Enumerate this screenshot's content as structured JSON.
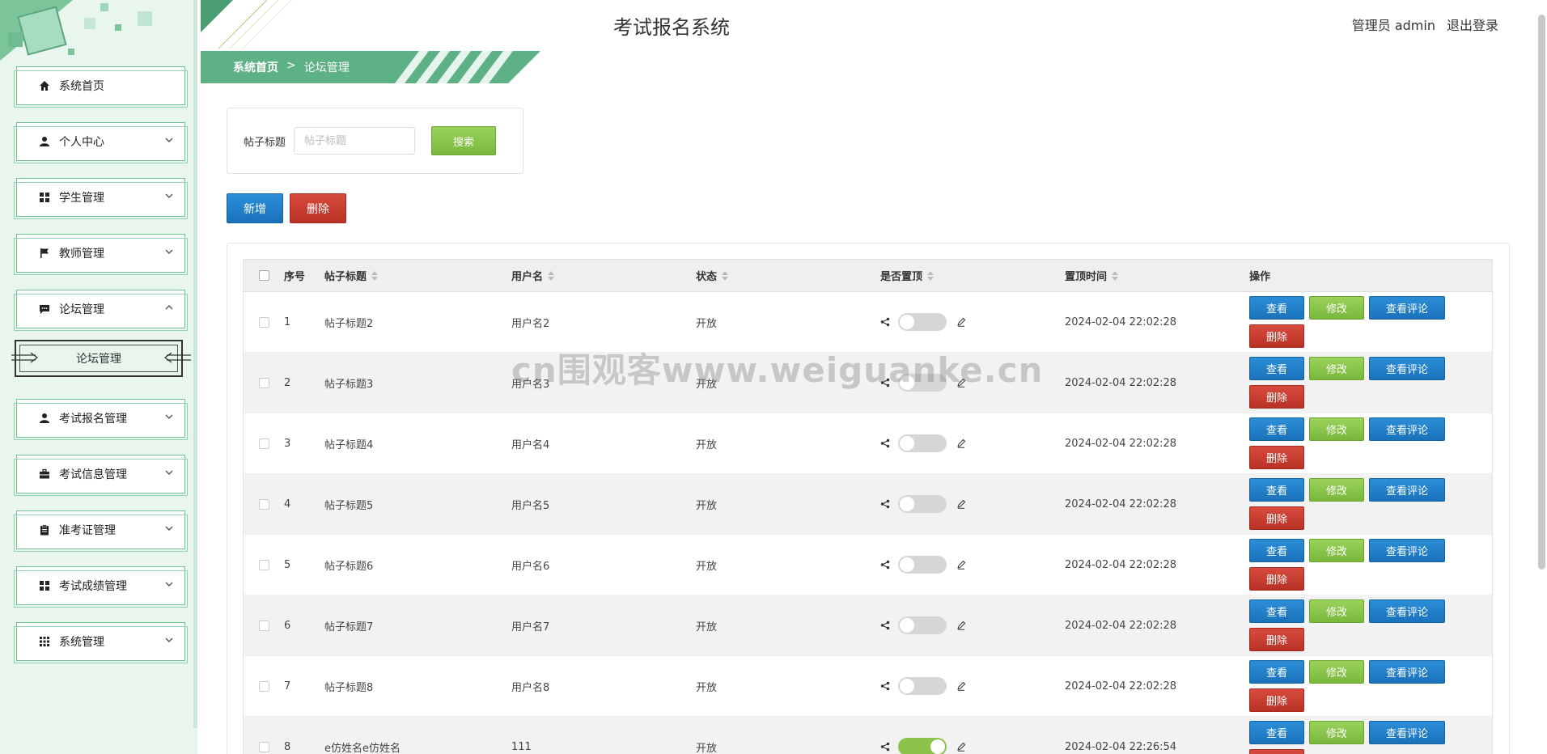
{
  "app": {
    "title": "考试报名系统"
  },
  "header": {
    "user": "管理员 admin",
    "logout": "退出登录"
  },
  "breadcrumb": {
    "home": "系统首页",
    "sep": ">",
    "current": "论坛管理"
  },
  "sidebar": {
    "items": [
      {
        "label": "系统首页",
        "icon": "home-icon"
      },
      {
        "label": "个人中心",
        "icon": "user-icon"
      },
      {
        "label": "学生管理",
        "icon": "grid-icon"
      },
      {
        "label": "教师管理",
        "icon": "flag-icon"
      },
      {
        "label": "论坛管理",
        "icon": "chat-icon"
      },
      {
        "label": "考试报名管理",
        "icon": "user-icon"
      },
      {
        "label": "考试信息管理",
        "icon": "briefcase-icon"
      },
      {
        "label": "准考证管理",
        "icon": "clipboard-icon"
      },
      {
        "label": "考试成绩管理",
        "icon": "grid-icon"
      },
      {
        "label": "系统管理",
        "icon": "apps-icon"
      }
    ],
    "sub_item": "论坛管理"
  },
  "search": {
    "label": "帖子标题",
    "placeholder": "帖子标题",
    "button": "搜索"
  },
  "actions": {
    "add": "新增",
    "delete": "删除"
  },
  "table": {
    "headers": {
      "no": "序号",
      "title": "帖子标题",
      "user": "用户名",
      "status": "状态",
      "top": "是否置顶",
      "time": "置顶时间",
      "ops": "操作"
    },
    "op_labels": {
      "view": "查看",
      "edit": "修改",
      "comments": "查看评论",
      "delete": "删除"
    },
    "rows": [
      {
        "no": "1",
        "title": "帖子标题2",
        "user": "用户名2",
        "status": "开放",
        "top": false,
        "time": "2024-02-04 22:02:28"
      },
      {
        "no": "2",
        "title": "帖子标题3",
        "user": "用户名3",
        "status": "开放",
        "top": false,
        "time": "2024-02-04 22:02:28"
      },
      {
        "no": "3",
        "title": "帖子标题4",
        "user": "用户名4",
        "status": "开放",
        "top": false,
        "time": "2024-02-04 22:02:28"
      },
      {
        "no": "4",
        "title": "帖子标题5",
        "user": "用户名5",
        "status": "开放",
        "top": false,
        "time": "2024-02-04 22:02:28"
      },
      {
        "no": "5",
        "title": "帖子标题6",
        "user": "用户名6",
        "status": "开放",
        "top": false,
        "time": "2024-02-04 22:02:28"
      },
      {
        "no": "6",
        "title": "帖子标题7",
        "user": "用户名7",
        "status": "开放",
        "top": false,
        "time": "2024-02-04 22:02:28"
      },
      {
        "no": "7",
        "title": "帖子标题8",
        "user": "用户名8",
        "status": "开放",
        "top": false,
        "time": "2024-02-04 22:02:28"
      },
      {
        "no": "8",
        "title": "e仿姓名e仿姓名",
        "user": "111",
        "status": "开放",
        "top": true,
        "time": "2024-02-04 22:26:54"
      }
    ]
  },
  "watermark": "cn围观客www.weiguanke.cn",
  "colors": {
    "green": "#8bc34a",
    "blue": "#1a72bb",
    "red": "#c0392b",
    "sidebar_bg": "#e8f6ee",
    "band": "#5db185"
  }
}
